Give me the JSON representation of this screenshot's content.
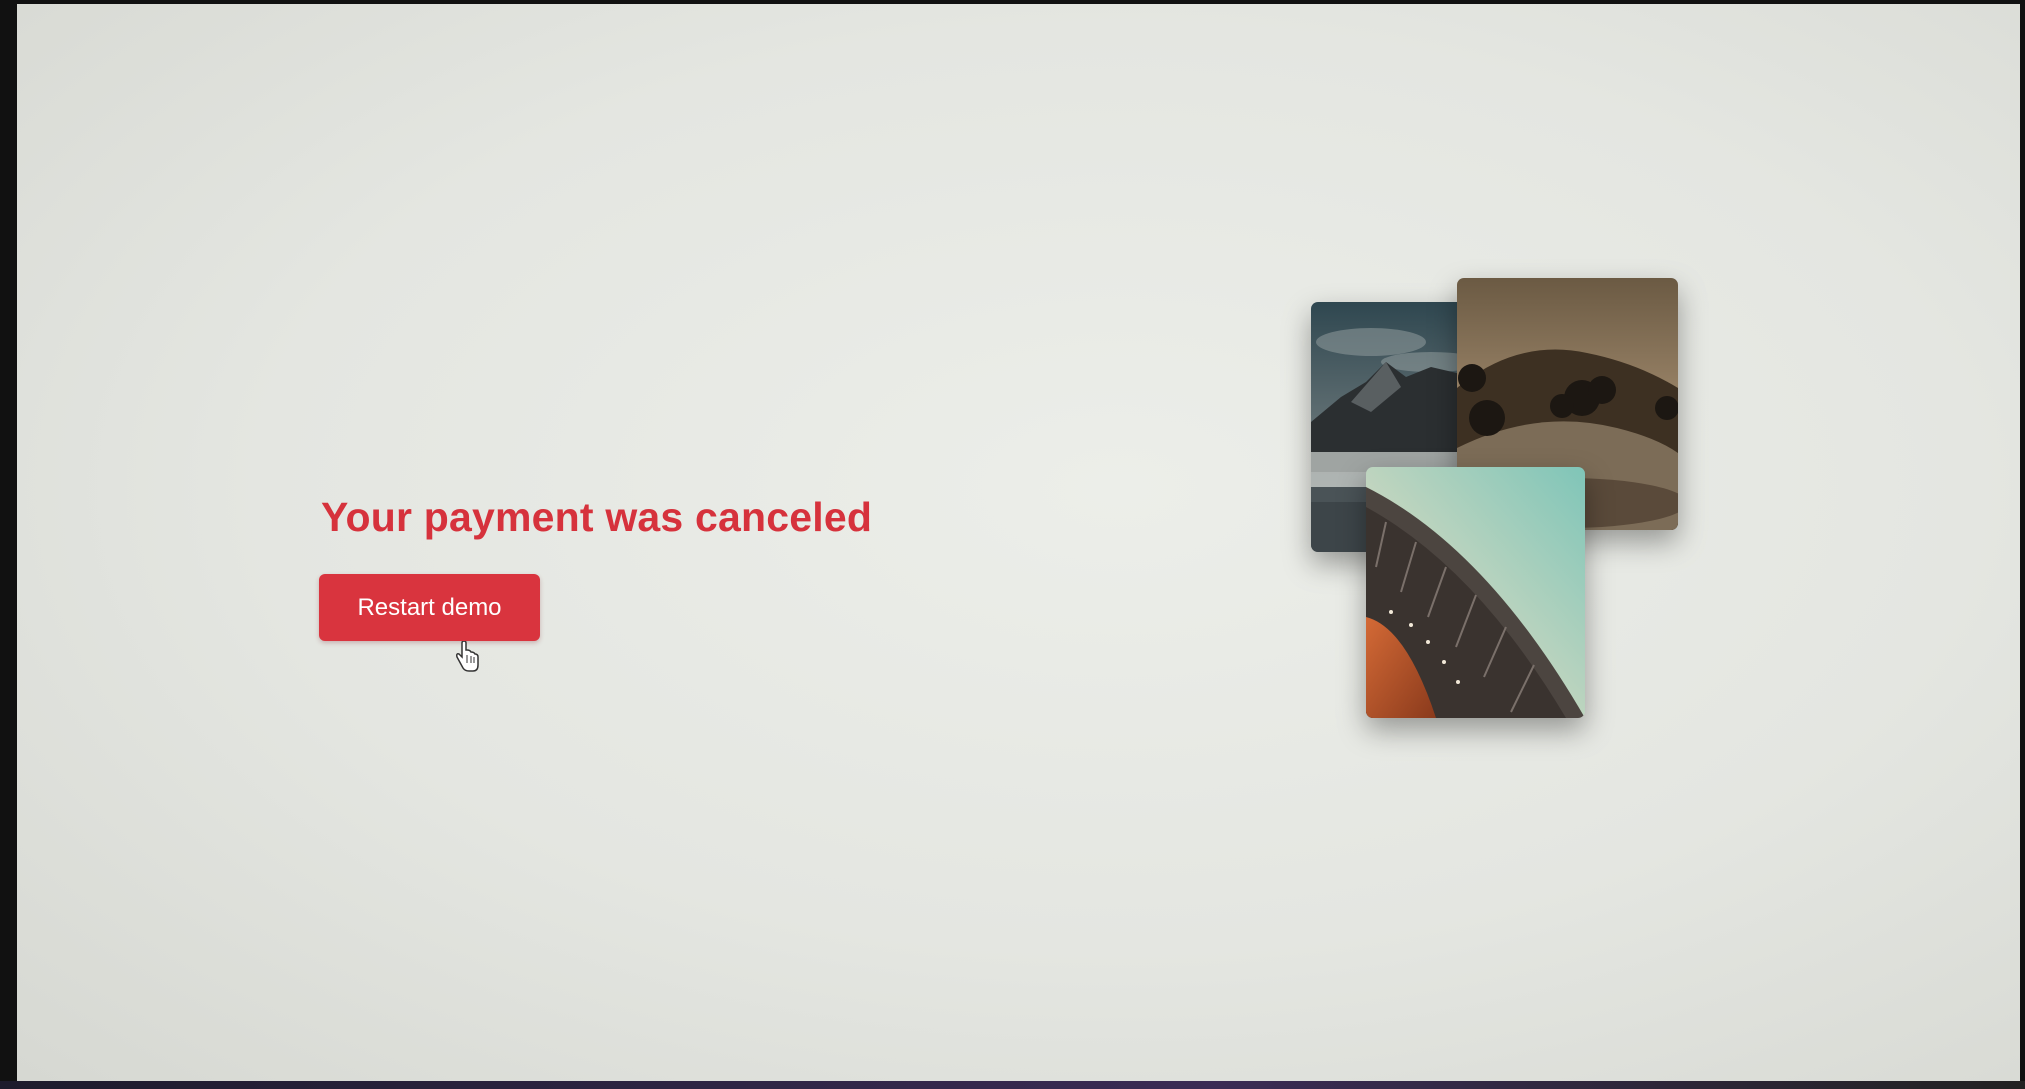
{
  "message": {
    "title": "Your payment was canceled",
    "button_label": "Restart demo"
  },
  "colors": {
    "accent": "#d9343e",
    "title": "#d6323c",
    "background": "#e8eae5"
  },
  "gallery": {
    "images": [
      {
        "name": "mountain-lake-photo"
      },
      {
        "name": "hills-trees-photo"
      },
      {
        "name": "architecture-arch-photo"
      }
    ]
  },
  "cursor": {
    "icon": "hand-pointer-icon"
  }
}
